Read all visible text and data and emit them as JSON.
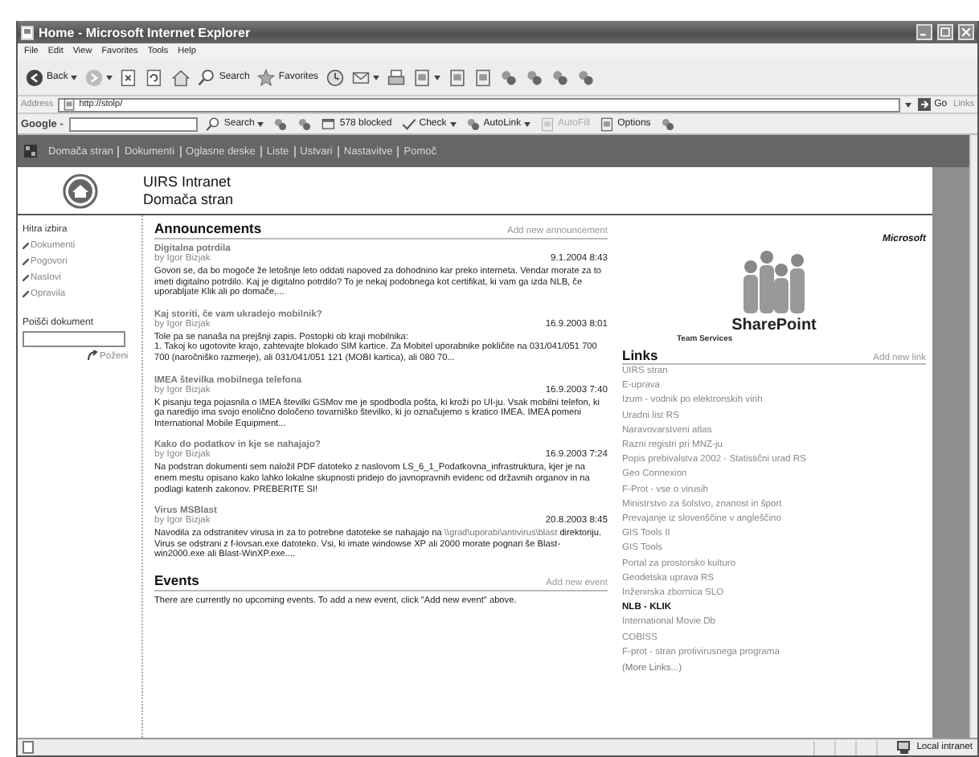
{
  "window": {
    "title": "Home - Microsoft Internet Explorer"
  },
  "menu": [
    "File",
    "Edit",
    "View",
    "Favorites",
    "Tools",
    "Help"
  ],
  "toolbar": [
    {
      "kind": "back",
      "label": "Back",
      "dropdown": true
    },
    {
      "kind": "forward",
      "dropdown": true
    },
    {
      "kind": "stop",
      "dropdown": false
    },
    {
      "kind": "refresh",
      "dropdown": false
    },
    {
      "kind": "home",
      "dropdown": false
    },
    {
      "kind": "search",
      "label": "Search",
      "dropdown": false
    },
    {
      "kind": "favorites",
      "label": "Favorites",
      "dropdown": false
    },
    {
      "kind": "history",
      "dropdown": false
    },
    {
      "kind": "mail",
      "dropdown": true
    },
    {
      "kind": "print",
      "dropdown": false
    },
    {
      "kind": "page",
      "dropdown": true
    },
    {
      "kind": "page",
      "dropdown": false
    },
    {
      "kind": "page",
      "dropdown": false
    },
    {
      "kind": "tool",
      "dropdown": false
    },
    {
      "kind": "tool",
      "dropdown": false
    },
    {
      "kind": "tool",
      "dropdown": false
    },
    {
      "kind": "tool",
      "dropdown": false
    }
  ],
  "address": {
    "label": "Address",
    "value": "http://stolp/",
    "go": "Go",
    "links": "Links"
  },
  "google_bar": {
    "logo": "Google -",
    "buttons": [
      {
        "kind": "search",
        "label": "Search",
        "dropdown": true,
        "disabled": false
      },
      {
        "kind": "tool",
        "dropdown": false,
        "disabled": false
      },
      {
        "kind": "tool",
        "dropdown": false,
        "disabled": false
      },
      {
        "kind": "popup",
        "label": "578 blocked",
        "dropdown": false,
        "disabled": false
      },
      {
        "kind": "check",
        "label": "Check",
        "dropdown": true,
        "disabled": false
      },
      {
        "kind": "tool",
        "label": "AutoLink",
        "dropdown": true,
        "disabled": false
      },
      {
        "kind": "page",
        "label": "AutoFill",
        "dropdown": false,
        "disabled": true
      },
      {
        "kind": "page",
        "label": "Options",
        "dropdown": false,
        "disabled": false
      },
      {
        "kind": "tool",
        "dropdown": false,
        "disabled": false
      }
    ]
  },
  "site_nav": [
    "Domača stran",
    "Dokumenti",
    "Oglasne deske",
    "Liste",
    "Ustvari",
    "Nastavitve",
    "Pomoč"
  ],
  "header": {
    "title": "UIRS Intranet",
    "subtitle": "Domača stran"
  },
  "quick_links": {
    "title": "Hitra izbira",
    "items": [
      "Dokumenti",
      "Pogovori",
      "Naslovi",
      "Opravila"
    ]
  },
  "doc_search": {
    "label": "Poišči dokument",
    "button": "Poženi"
  },
  "announcements": {
    "title": "Announcements",
    "add": "Add new announcement",
    "items": [
      {
        "title": "Digitalna potrdila",
        "author": "by Igor Bizjak",
        "date": "9.1.2004 8:43",
        "body": [
          {
            "kind": "text",
            "text": "Govori se, da bo mogoče že letošnje leto oddati napoved za dohodnino kar preko interneta. Vendar morate za to imeti digitalno potrdilo. Kaj je digitalno potrdilo? To je nekaj podobnega kot certifikat, ki vam ga izda NLB, če uporabljate Klik ali po domače,..."
          }
        ]
      },
      {
        "title": "Kaj storiti, če vam ukradejo mobilnik?",
        "author": "by Igor Bizjak",
        "date": "16.9.2003 8:01",
        "body": [
          {
            "kind": "text",
            "text": "Tole pa se nanaša na prejšnji zapis. Postopki ob kraji mobilnika:\n1. Takoj ko ugotovite krajo, zahtevajte blokado SIM kartice. Za Mobitel uporabnike pokličite na 031/041/051 700 700 (naročniško razmerje), ali 031/041/051 121 (MOBI kartica), ali 080 70..."
          }
        ]
      },
      {
        "title": "IMEA številka mobilnega telefona",
        "author": "by Igor Bizjak",
        "date": "16.9.2003 7:40",
        "body": [
          {
            "kind": "text",
            "text": "K pisanju tega pojasnila o IMEA številki GSMov me je spodbodla pošta, ki kroži po UI-ju. Vsak mobilni telefon, ki ga naredijo ima svojo enolično določeno tovarniško številko, ki jo označujemo s kratico IMEA. IMEA pomeni International Mobile Equipment..."
          }
        ]
      },
      {
        "title": "Kako do podatkov in kje se nahajajo?",
        "author": "by Igor Bizjak",
        "date": "16.9.2003 7:24",
        "body": [
          {
            "kind": "text",
            "text": "Na podstran dokumenti sem naložil PDF datoteko z naslovom LS_6_1_Podatkovna_infrastruktura, kjer je na enem mestu opisano kako lahko lokalne skupnosti pridejo do javnopravnih evidenc od državnih organov in na podlagi katerih zakonov. PREBERITE SI!"
          }
        ]
      },
      {
        "title": "Virus MSBlast",
        "author": "by Igor Bizjak",
        "date": "20.8.2003 8:45",
        "body": [
          {
            "kind": "text",
            "text": "Navodila za odstranitev virusa in za to potrebne datoteke se nahajajo na "
          },
          {
            "kind": "link",
            "text": "\\\\grad\\uporabi\\antivirus\\blast"
          },
          {
            "kind": "text",
            "text": " direktoriju. Virus se odstrani z f-lovsan.exe datoteko. Vsi, ki imate windowse XP ali 2000 morate pognari še Blast-win2000.exe ali Blast-WinXP.exe...."
          }
        ]
      }
    ]
  },
  "events": {
    "title": "Events",
    "add": "Add new event",
    "empty": "There are currently no upcoming events. To add a new event, click \"Add new event\" above."
  },
  "logo": {
    "brand": "Microsoft",
    "name": "SharePoint",
    "tagline": "Team Services"
  },
  "links": {
    "title": "Links",
    "add": "Add new link",
    "more": "(More Links...)",
    "items": [
      {
        "label": "UIRS stran",
        "visited": false
      },
      {
        "label": "E-uprava",
        "visited": false
      },
      {
        "label": "Izum - vodnik po elektronskih virih",
        "visited": false
      },
      {
        "label": "Uradni list RS",
        "visited": false
      },
      {
        "label": "Naravovarstveni atlas",
        "visited": false
      },
      {
        "label": "Razni registri pri MNZ-ju",
        "visited": false
      },
      {
        "label": "Popis prebivalstva 2002 - Statistični urad RS",
        "visited": false
      },
      {
        "label": "Geo Connexion",
        "visited": false
      },
      {
        "label": "F-Prot - vse o virusih",
        "visited": false
      },
      {
        "label": "Ministrstvo za šolstvo, znanost in šport",
        "visited": false
      },
      {
        "label": "Prevajanje iz slovenščine v angleščino",
        "visited": false
      },
      {
        "label": "GIS Tools II",
        "visited": false
      },
      {
        "label": "GIS Tools",
        "visited": false
      },
      {
        "label": "Portal za prostorsko kulturo",
        "visited": false
      },
      {
        "label": "Geodetska uprava RS",
        "visited": false
      },
      {
        "label": "Inženirska zbornica SLO",
        "visited": false
      },
      {
        "label": "NLB - KLIK",
        "visited": true
      },
      {
        "label": "International Movie Db",
        "visited": false
      },
      {
        "label": "COBISS",
        "visited": false
      },
      {
        "label": "F-prot - stran protivirusnega programa",
        "visited": false
      }
    ]
  },
  "status_bar": {
    "zone": "Local intranet"
  }
}
